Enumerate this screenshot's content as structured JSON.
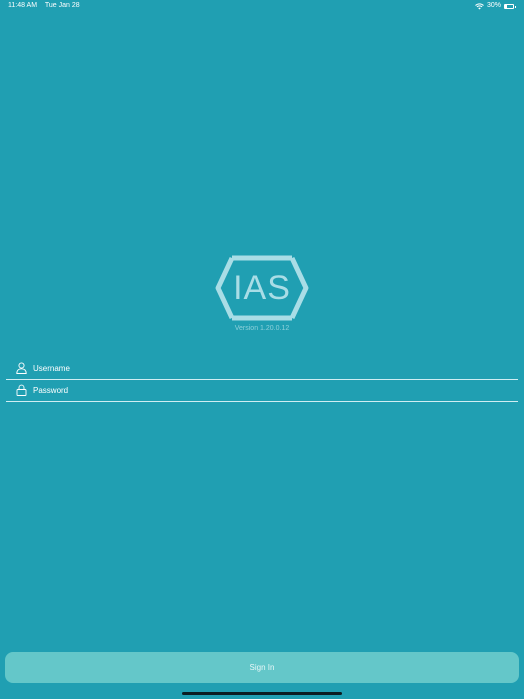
{
  "status_bar": {
    "time": "11:48 AM",
    "date": "Tue Jan 28",
    "battery_percent": "30%",
    "battery_level": 0.3,
    "icons": [
      "wifi-icon",
      "battery-icon"
    ]
  },
  "logo": {
    "text": "IAS",
    "color": "#a9dde6"
  },
  "version": "Version 1.20.0.12",
  "form": {
    "username_placeholder": "Username",
    "password_placeholder": "Password",
    "username_icon": "user-icon",
    "password_icon": "lock-icon"
  },
  "sign_in_label": "Sign In",
  "colors": {
    "background": "#209fb2",
    "button": "#64c7c9",
    "field_line": "#cfeef3"
  }
}
